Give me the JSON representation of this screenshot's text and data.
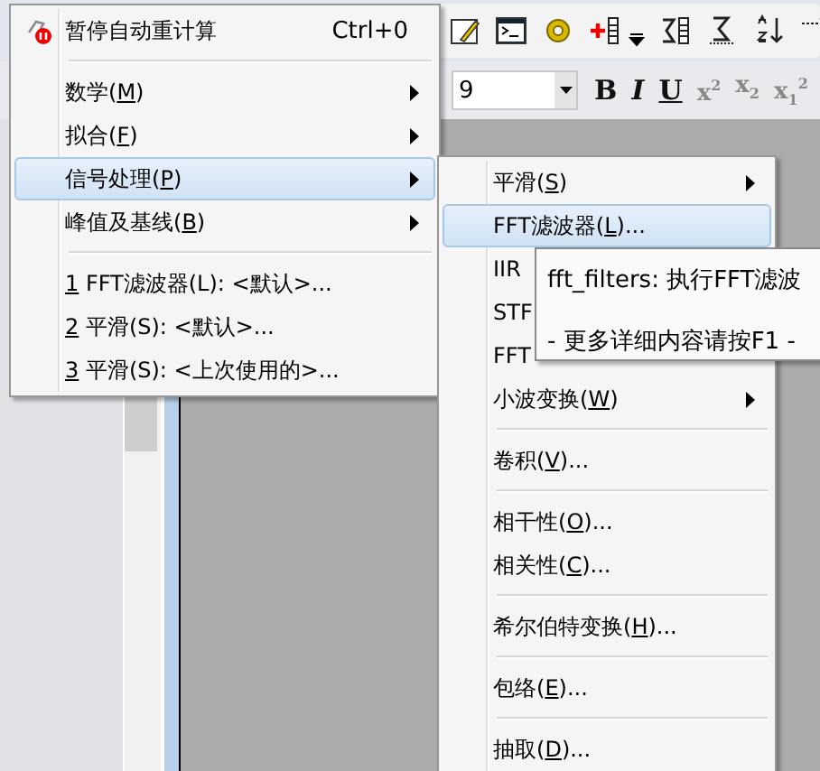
{
  "toolbar": {
    "font_size": "9",
    "format_buttons": [
      {
        "kind": "bold",
        "text": "B"
      },
      {
        "kind": "italic",
        "text": "I"
      },
      {
        "kind": "underline",
        "text": "U"
      },
      {
        "kind": "script",
        "text": "x$^{2}$"
      },
      {
        "kind": "script",
        "text": "x$_{2}$"
      },
      {
        "kind": "script",
        "text": "x$_{1}$$^{2}$"
      }
    ]
  },
  "main_menu": {
    "items": [
      {
        "kind": "command",
        "pre": "暂停自动重计算",
        "shortcut": "Ctrl+0",
        "selected": false
      },
      {
        "kind": "separator"
      },
      {
        "kind": "submenu",
        "pre": "数学(",
        "key": "M",
        "post": ")",
        "selected": false
      },
      {
        "kind": "submenu",
        "pre": "拟合(",
        "key": "F",
        "post": ")",
        "selected": false
      },
      {
        "kind": "submenu",
        "pre": "信号处理(",
        "key": "P",
        "post": ")",
        "selected": true
      },
      {
        "kind": "submenu",
        "pre": "峰值及基线(",
        "key": "B",
        "post": ")",
        "selected": false
      },
      {
        "kind": "separator"
      },
      {
        "kind": "command",
        "key": "1",
        "post": " FFT滤波器(L): <默认>...",
        "selected": false
      },
      {
        "kind": "command",
        "key": "2",
        "post": " 平滑(S): <默认>...",
        "selected": false
      },
      {
        "kind": "command",
        "key": "3",
        "post": " 平滑(S): <上次使用的>...",
        "selected": false
      }
    ]
  },
  "signal_menu": {
    "items": [
      {
        "kind": "submenu",
        "pre": "平滑(",
        "key": "S",
        "post": ")",
        "selected": false
      },
      {
        "kind": "command",
        "pre": "FFT滤波器(",
        "key": "L",
        "post": ")...",
        "selected": true
      },
      {
        "kind": "command",
        "pre": "IIR",
        "selected": false
      },
      {
        "kind": "command",
        "pre": "STF",
        "selected": false
      },
      {
        "kind": "command",
        "pre": "FFT",
        "selected": false
      },
      {
        "kind": "submenu",
        "pre": "小波变换(",
        "key": "W",
        "post": ")",
        "selected": false
      },
      {
        "kind": "separator"
      },
      {
        "kind": "command",
        "pre": "卷积(",
        "key": "V",
        "post": ")...",
        "selected": false
      },
      {
        "kind": "separator"
      },
      {
        "kind": "command",
        "pre": "相干性(",
        "key": "O",
        "post": ")...",
        "selected": false
      },
      {
        "kind": "command",
        "pre": "相关性(",
        "key": "C",
        "post": ")...",
        "selected": false
      },
      {
        "kind": "separator"
      },
      {
        "kind": "command",
        "pre": "希尔伯特变换(",
        "key": "H",
        "post": ")...",
        "selected": false
      },
      {
        "kind": "separator"
      },
      {
        "kind": "command",
        "pre": "包络(",
        "key": "E",
        "post": ")...",
        "selected": false
      },
      {
        "kind": "separator"
      },
      {
        "kind": "command",
        "pre": "抽取(",
        "key": "D",
        "post": ")...",
        "selected": false
      }
    ]
  },
  "tooltip": {
    "title": "fft_filters: 执行FFT滤波",
    "hint": "- 更多详细内容请按F1 -"
  }
}
